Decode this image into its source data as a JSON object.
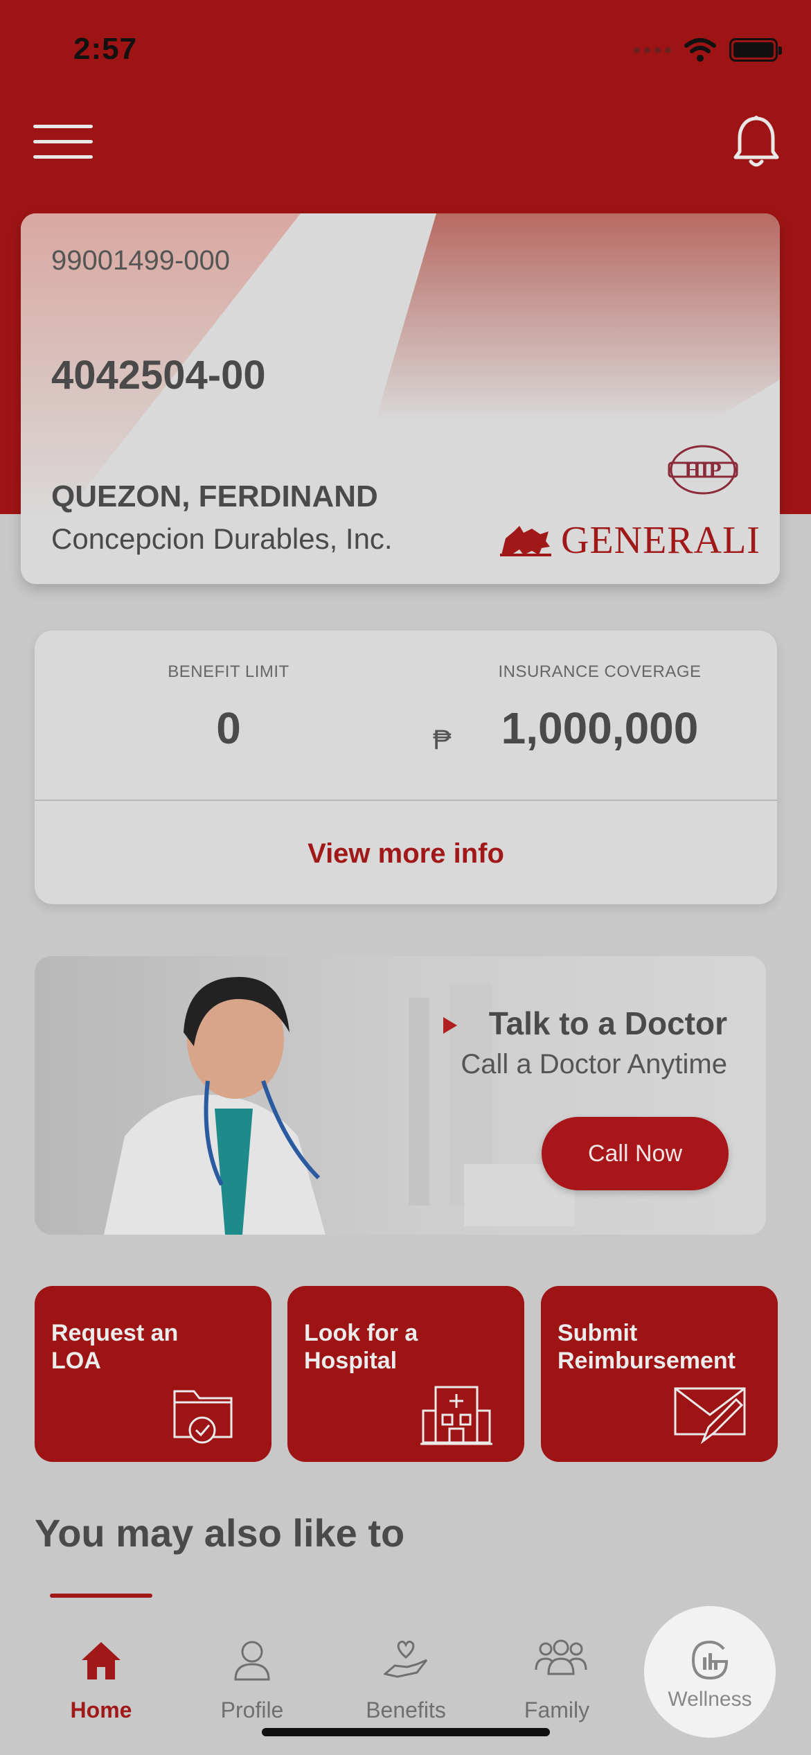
{
  "status_bar": {
    "time": "2:57"
  },
  "header": {
    "menu_icon": "hamburger-icon",
    "notification_icon": "bell-icon"
  },
  "member_card": {
    "policy_number": "99001499-000",
    "member_number": "4042504-00",
    "member_name": "QUEZON, FERDINAND",
    "company": "Concepcion Durables, Inc.",
    "insurer": "GENERALI",
    "hip_logo_text": "HIP"
  },
  "benefits": {
    "benefit_limit_label": "BENEFIT LIMIT",
    "benefit_limit_value": "0",
    "insurance_coverage_label": "INSURANCE COVERAGE",
    "currency_symbol": "₱",
    "insurance_coverage_value": "1,000,000",
    "view_more_label": "View more info"
  },
  "doctor_banner": {
    "title": "Talk to a Doctor",
    "subtitle": "Call a Doctor Anytime",
    "button_label": "Call Now"
  },
  "actions": [
    {
      "label_line1": "Request an",
      "label_line2": "LOA",
      "icon": "folder-check-icon"
    },
    {
      "label_line1": "Look for a",
      "label_line2": "Hospital",
      "icon": "hospital-icon"
    },
    {
      "label_line1": "Submit",
      "label_line2": "Reimbursement",
      "icon": "envelope-pen-icon"
    }
  ],
  "section": {
    "heading": "You may also like to"
  },
  "tabs": [
    {
      "label": "Home",
      "icon": "home-icon",
      "active": true
    },
    {
      "label": "Profile",
      "icon": "user-icon",
      "active": false
    },
    {
      "label": "Benefits",
      "icon": "heart-hand-icon",
      "active": false
    },
    {
      "label": "Family",
      "icon": "family-icon",
      "active": false
    },
    {
      "label": "Wellness",
      "icon": "wellness-icon",
      "active": false
    }
  ],
  "colors": {
    "brand_red": "#9e1414",
    "accent_red": "#a01818",
    "background": "#c8c8c8"
  }
}
